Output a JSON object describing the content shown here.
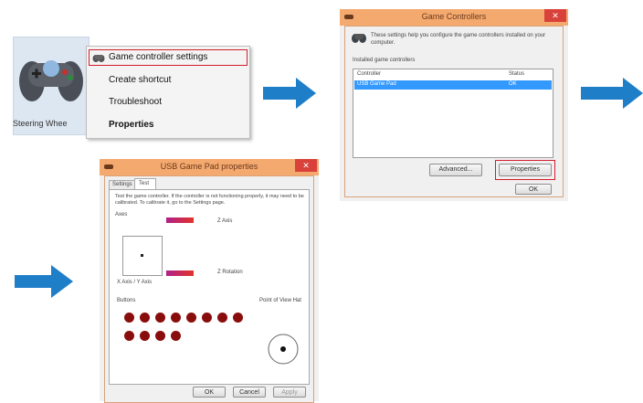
{
  "colors": {
    "arrow": "#1f7ec8",
    "highlight": "#d21d2b",
    "window_frame": "#f4a96e",
    "close_button": "#d9413b",
    "selection": "#3399ff",
    "button_dot": "#8a0d0d"
  },
  "panel1": {
    "device_label": "Steering Whee",
    "menu": {
      "items": [
        "Game controller settings",
        "Create shortcut",
        "Troubleshoot",
        "Properties"
      ]
    }
  },
  "panel2": {
    "title": "Game Controllers",
    "close_glyph": "✕",
    "description": "These settings help you configure the game controllers installed on your computer.",
    "group_label": "Installed game controllers",
    "columns": [
      "Controller",
      "Status"
    ],
    "rows": [
      {
        "controller": "USB Game Pad",
        "status": "OK"
      }
    ],
    "buttons": {
      "advanced": "Advanced...",
      "properties": "Properties",
      "ok": "OK"
    }
  },
  "panel3": {
    "title": "USB Game Pad  properties",
    "close_glyph": "✕",
    "tabs": [
      "Settings",
      "Test"
    ],
    "instructions": "Test the game controller. If the controller is not functioning properly, it may need to be calibrated. To calibrate it, go to the Settings page.",
    "axes_label": "Axes",
    "z_axis": "Z Axis",
    "z_rotation": "Z Rotation",
    "xy_label": "X Axis / Y Axis",
    "buttons_label": "Buttons",
    "pov_label": "Point of View Hat",
    "dialog_buttons": {
      "ok": "OK",
      "cancel": "Cancel",
      "apply": "Apply"
    }
  }
}
